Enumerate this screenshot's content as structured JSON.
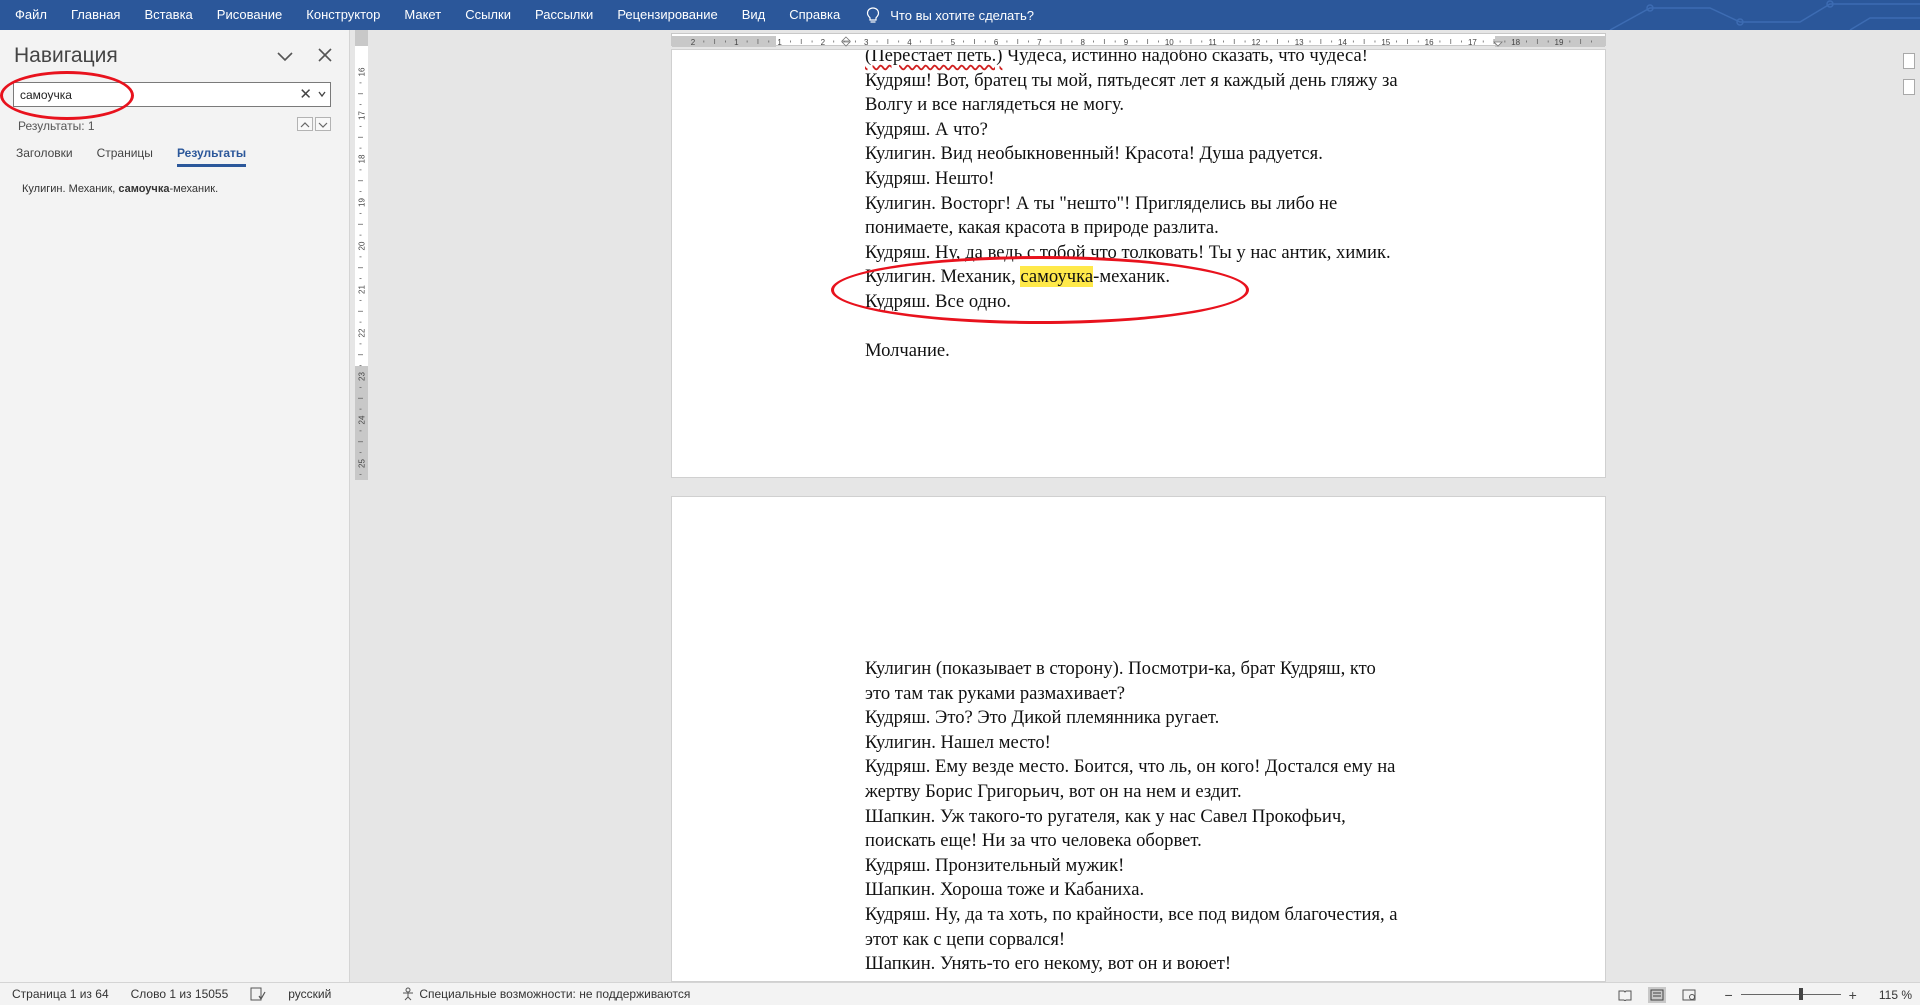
{
  "ribbon": {
    "tabs": [
      "Файл",
      "Главная",
      "Вставка",
      "Рисование",
      "Конструктор",
      "Макет",
      "Ссылки",
      "Рассылки",
      "Рецензирование",
      "Вид",
      "Справка"
    ],
    "tell_me": "Что вы хотите сделать?",
    "accent_color": "#2b579a"
  },
  "nav": {
    "title": "Навигация",
    "search_value": "самоучка",
    "results_count": "Результаты: 1",
    "tabs": [
      "Заголовки",
      "Страницы",
      "Результаты"
    ],
    "active_tab": "Результаты",
    "result": {
      "prefix": "Кулигин. Механик, ",
      "match": "самоучка",
      "suffix": "-механик."
    }
  },
  "rulers": {
    "horizontal_numbers": [
      "2",
      "1",
      "1",
      "2",
      "3",
      "4",
      "5",
      "6",
      "7",
      "8",
      "9",
      "10",
      "11",
      "12",
      "13",
      "14",
      "15",
      "16",
      "17",
      "18",
      "19"
    ],
    "vertical_numbers": [
      "16",
      "17",
      "18",
      "19",
      "20",
      "21",
      "22",
      "23",
      "24",
      "25"
    ]
  },
  "page1": {
    "lines": [
      {
        "spell": "(Перестает петь.)",
        "text": " Чудеса, истинно надобно сказать, что чудеса!"
      },
      {
        "text": "Кудряш! Вот, братец ты мой, пятьдесят лет я каждый день гляжу за"
      },
      {
        "text": "Волгу и все наглядеться не могу."
      },
      {
        "text": " Кудряш. А что?"
      },
      {
        "text": " Кулигин. Вид необыкновенный! Красота! Душа радуется."
      },
      {
        "text": " Кудряш. Нешто!"
      },
      {
        "text": " Кулигин. Восторг! А ты \"нешто\"! Пригляделись вы либо не"
      },
      {
        "text": "понимаете, какая красота в природе разлита."
      },
      {
        "text": " Кудряш. Ну, да ведь с тобой что толковать! Ты у нас антик, химик."
      },
      {
        "text": " Кулигин. Механик, ",
        "highlight": "самоучка",
        "after": "-механик."
      },
      {
        "text": "Кудряш. Все одно."
      },
      {
        "text": ""
      },
      {
        "text": "Молчание."
      }
    ]
  },
  "page2": {
    "lines": [
      " Кулигин (показывает в сторону). Посмотри-ка, брат Кудряш, кто",
      "это там так руками размахивает?",
      " Кудряш. Это? Это Дикой племянника ругает.",
      " Кулигин. Нашел место!",
      " Кудряш. Ему везде место. Боится, что ль, он кого! Достался ему на",
      "жертву Борис Григорьич, вот он на нем и ездит.",
      " Шапкин. Уж такого-то ругателя, как у нас Савел Прокофьич,",
      "поискать еще! Ни за что человека оборвет.",
      " Кудряш. Пронзительный мужик!",
      " Шапкин. Хороша тоже и Кабаниха.",
      " Кудряш. Ну, да та хоть, по крайности, все под видом благочестия, а",
      "этот как с цепи сорвался!",
      " Шапкин. Унять-то его некому, вот он и воюет!"
    ]
  },
  "status": {
    "page": "Страница 1 из 64",
    "words": "Слово 1 из 15055",
    "language": "русский",
    "accessibility": "Специальные возможности: не поддерживаются",
    "zoom": "115 %"
  }
}
